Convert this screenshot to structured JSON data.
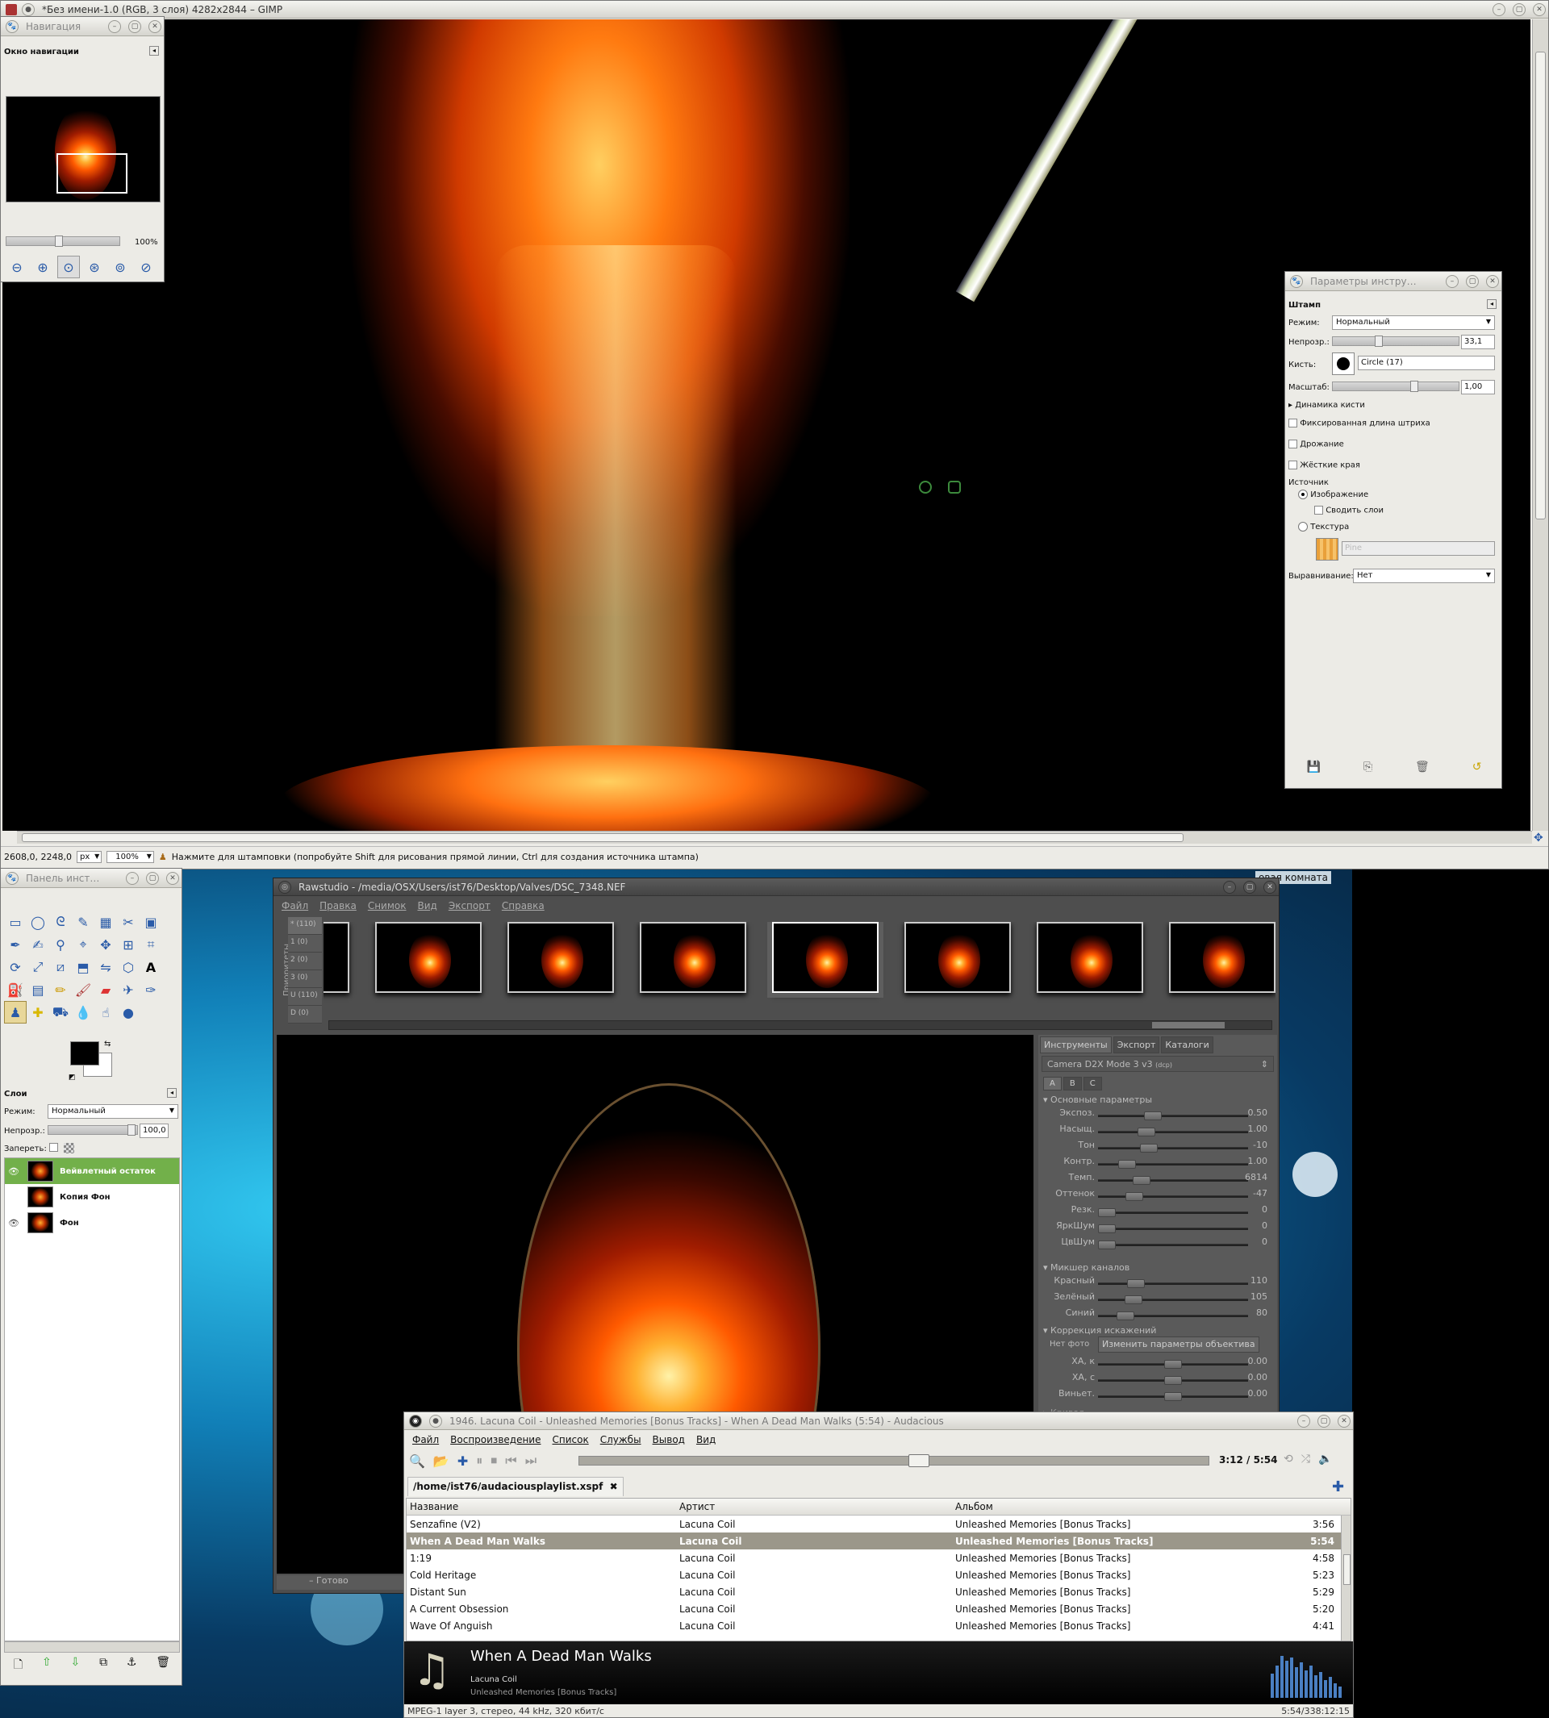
{
  "gimp_main": {
    "title": "*Без имени-1.0 (RGB, 3 слоя) 4282x2844 – GIMP",
    "coords": "2608,0, 2248,0",
    "unit": "px",
    "zoom": "100%",
    "status": "Нажмите для штамповки (попробуйте Shift для рисования прямой линии, Ctrl для создания источника штампа)"
  },
  "navigation": {
    "title": "Навигация",
    "header": "Окно навигации",
    "zoom": "100%",
    "zoom_level": 1.0
  },
  "tool_options": {
    "title": "Параметры инстру…",
    "tool_name": "Штамп",
    "mode_label": "Режим:",
    "mode_value": "Нормальный",
    "opacity_label": "Непрозр.:",
    "opacity_value": "33,1",
    "brush_label": "Кисть:",
    "brush_value": "Circle (17)",
    "scale_label": "Масштаб:",
    "scale_value": "1,00",
    "dynamics": "Динамика кисти",
    "fixed_stroke": "Фиксированная длина штриха",
    "jitter": "Дрожание",
    "hard_edges": "Жёсткие края",
    "source_label": "Источник",
    "source_image": "Изображение",
    "merge_layers": "Сводить слои",
    "source_texture": "Текстура",
    "texture_name": "Pine",
    "align_label": "Выравнивание:",
    "align_value": "Нет"
  },
  "toolbox": {
    "title": "Панель инст…",
    "layers_header": "Слои",
    "mode_label": "Режим:",
    "mode_value": "Нормальный",
    "opacity_label": "Непрозр.:",
    "opacity_value": "100,0",
    "lock_label": "Запереть:",
    "layers": [
      {
        "name": "Вейвлетный остаток",
        "visible": true,
        "selected": true
      },
      {
        "name": "Копия Фон",
        "visible": false,
        "selected": false
      },
      {
        "name": "Фон",
        "visible": true,
        "selected": false
      }
    ]
  },
  "rawstudio": {
    "title": "Rawstudio - /media/OSX/Users/ist76/Desktop/Valves/DSC_7348.NEF",
    "menu": [
      "Файл",
      "Правка",
      "Снимок",
      "Вид",
      "Экспорт",
      "Справка"
    ],
    "priorities_label": "Приоритеты",
    "priorities": [
      "* (110)",
      "1 (0)",
      "2 (0)",
      "3 (0)",
      "U (110)",
      "D (0)"
    ],
    "tabs": [
      "Инструменты",
      "Экспорт",
      "Каталоги"
    ],
    "profile": "Camera D2X Mode 3 v3",
    "profile_suffix": "(dcp)",
    "subtabs": [
      "A",
      "B",
      "C"
    ],
    "basic_header": "Основные параметры",
    "basic": [
      {
        "name": "Экспоз.",
        "value": "0.50",
        "pos": 0.35
      },
      {
        "name": "Насыщ.",
        "value": "1.00",
        "pos": 0.3
      },
      {
        "name": "Тон",
        "value": "-10",
        "pos": 0.32
      },
      {
        "name": "Контр.",
        "value": "1.00",
        "pos": 0.15
      },
      {
        "name": "Темп.",
        "value": "6814",
        "pos": 0.26
      },
      {
        "name": "Оттенок",
        "value": "-47",
        "pos": 0.21
      },
      {
        "name": "Резк.",
        "value": "0",
        "pos": 0.0
      },
      {
        "name": "ЯркШум",
        "value": "0",
        "pos": 0.0
      },
      {
        "name": "ЦвШум",
        "value": "0",
        "pos": 0.0
      }
    ],
    "mixer_header": "Микшер каналов",
    "mixer": [
      {
        "name": "Красный",
        "value": "110",
        "pos": 0.22
      },
      {
        "name": "Зелёный",
        "value": "105",
        "pos": 0.2
      },
      {
        "name": "Синий",
        "value": "80",
        "pos": 0.14
      }
    ],
    "lens_header": "Коррекция искажений",
    "no_photo": "Нет фото",
    "lens_button": "Изменить параметры объектива",
    "lens": [
      {
        "name": "ХА, к",
        "value": "0.00",
        "pos": 0.5
      },
      {
        "name": "ХА, с",
        "value": "0.00",
        "pos": 0.5
      },
      {
        "name": "Виньет.",
        "value": "0.00",
        "pos": 0.5
      }
    ],
    "curve_header": "Кривая",
    "status": "Готово"
  },
  "audacious": {
    "title": "1946. Lacuna Coil - Unleashed Memories [Bonus Tracks] - When A Dead Man Walks (5:54) - Audacious",
    "menu": [
      "Файл",
      "Воспроизведение",
      "Список",
      "Службы",
      "Вывод",
      "Вид"
    ],
    "time": "3:12 / 5:54",
    "progress": 0.54,
    "playlist_tab": "/home/ist76/audaciousplaylist.xspf",
    "columns": [
      "Название",
      "Артист",
      "Альбом"
    ],
    "rows": [
      {
        "title": "Senzafine (V2)",
        "artist": "Lacuna Coil",
        "album": "Unleashed Memories [Bonus Tracks]",
        "len": "3:56",
        "current": false
      },
      {
        "title": "When A Dead Man Walks",
        "artist": "Lacuna Coil",
        "album": "Unleashed Memories [Bonus Tracks]",
        "len": "5:54",
        "current": true
      },
      {
        "title": "1:19",
        "artist": "Lacuna Coil",
        "album": "Unleashed Memories [Bonus Tracks]",
        "len": "4:58",
        "current": false
      },
      {
        "title": "Cold Heritage",
        "artist": "Lacuna Coil",
        "album": "Unleashed Memories [Bonus Tracks]",
        "len": "5:23",
        "current": false
      },
      {
        "title": "Distant Sun",
        "artist": "Lacuna Coil",
        "album": "Unleashed Memories [Bonus Tracks]",
        "len": "5:29",
        "current": false
      },
      {
        "title": "A Current Obsession",
        "artist": "Lacuna Coil",
        "album": "Unleashed Memories [Bonus Tracks]",
        "len": "5:20",
        "current": false
      },
      {
        "title": "Wave Of Anguish",
        "artist": "Lacuna Coil",
        "album": "Unleashed Memories [Bonus Tracks]",
        "len": "4:41",
        "current": false
      }
    ],
    "np_title": "When A Dead Man Walks",
    "np_artist": "Lacuna Coil",
    "np_album": "Unleashed Memories [Bonus Tracks]",
    "format": "MPEG-1 layer 3, стерео, 44 kHz, 320 кбит/с",
    "totals": "5:54/338:12:15"
  },
  "desktop": {
    "room_label": "овая комната"
  },
  "colors": {
    "accent_green": "#72b04a",
    "selected_row": "#9b978a",
    "dark_panel": "#5a5a5a"
  }
}
